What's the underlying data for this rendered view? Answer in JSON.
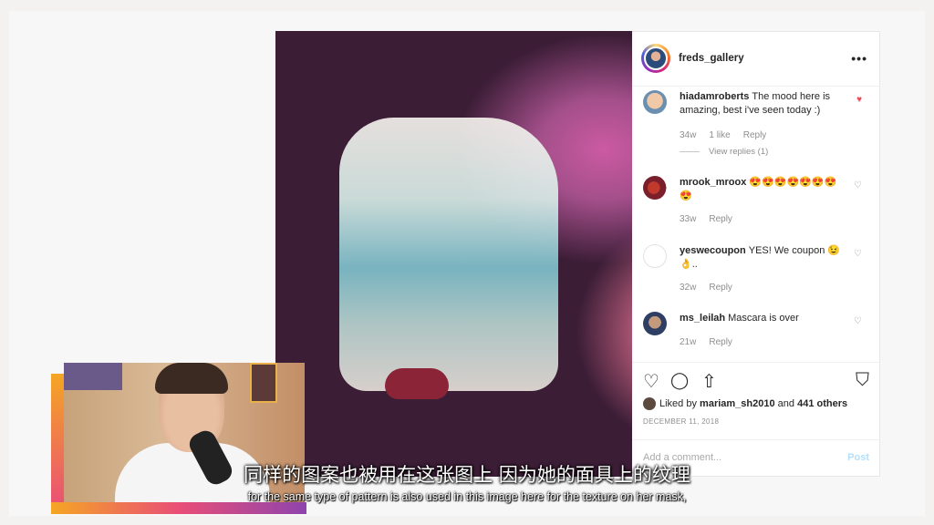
{
  "post": {
    "username": "freds_gallery",
    "more_icon": "more-options-icon",
    "comments": [
      {
        "user": "hiadamroberts",
        "text": "The mood here is amazing, best i've seen today :)",
        "age": "34w",
        "likes": "1 like",
        "reply": "Reply",
        "view_replies": "View replies (1)",
        "liked": true
      },
      {
        "user": "mrook_mroox",
        "text": "😍😍😍😍😍😍😍😍",
        "age": "33w",
        "reply": "Reply",
        "liked": false
      },
      {
        "user": "yeswecoupon",
        "text": "YES! We coupon 😉👌..",
        "age": "32w",
        "reply": "Reply",
        "liked": false
      },
      {
        "user": "ms_leilah",
        "text": "Mascara is over",
        "age": "21w",
        "reply": "Reply",
        "liked": false
      }
    ],
    "liked_by_prefix": "Liked by",
    "liked_by_user": "mariam_sh2010",
    "liked_by_and": "and",
    "liked_by_others": "441 others",
    "date": "DECEMBER 11, 2018",
    "add_comment_placeholder": "Add a comment...",
    "post_button": "Post"
  },
  "icons": {
    "heart": "♡",
    "comment": "◯",
    "share": "⇧",
    "bookmark": "⛉",
    "heart_filled": "♥",
    "more": "•••"
  },
  "subtitles": {
    "chinese": "同样的图案也被用在这张图上 因为她的面具上的纹理",
    "english": "for the same type of pattern is also used in this image here for the texture on her mask,"
  },
  "colors": {
    "like_red": "#ed4956",
    "muted": "#8e8e8e",
    "post_button_blue": "#b2dffc"
  }
}
